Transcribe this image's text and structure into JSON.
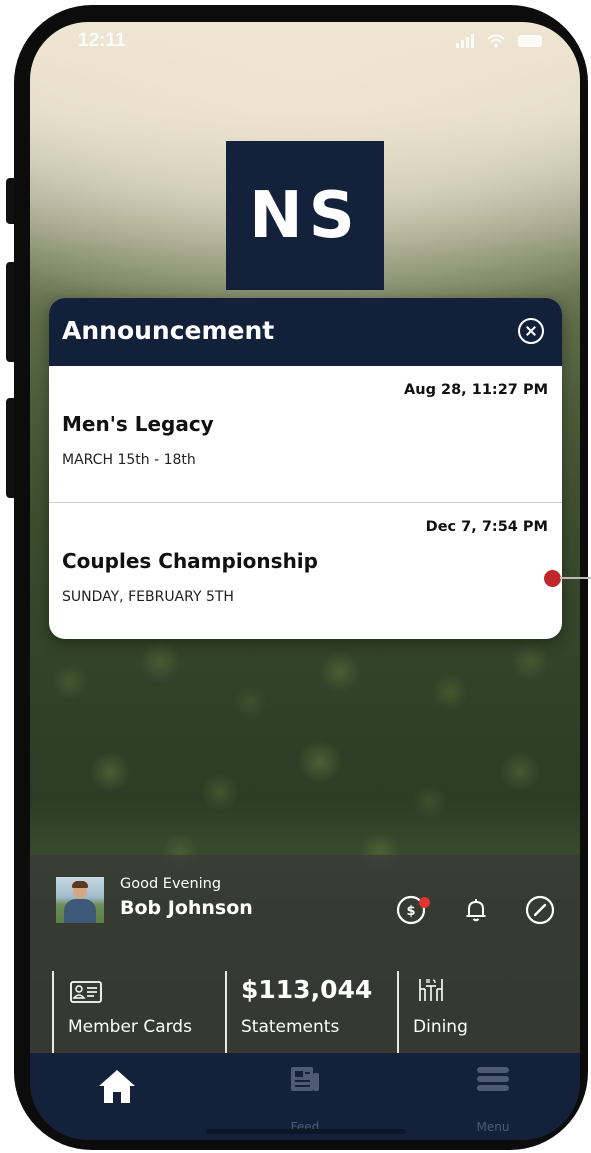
{
  "status_bar": {
    "time": "12:11"
  },
  "logo": {
    "text": "NS"
  },
  "announcement": {
    "title": "Announcement",
    "items": [
      {
        "date": "Aug 28, 11:27 PM",
        "title": "Men's Legacy",
        "subtitle": "MARCH 15th - 18th"
      },
      {
        "date": "Dec 7, 7:54 PM",
        "title": "Couples Championship",
        "subtitle": "SUNDAY, FEBRUARY 5TH"
      }
    ]
  },
  "user": {
    "greeting": "Good Evening",
    "name": "Bob Johnson"
  },
  "header_icons": [
    "dollar-icon",
    "bell-icon",
    "compass-icon"
  ],
  "tiles": [
    {
      "label": "Member Cards",
      "icon": "member-card-icon"
    },
    {
      "label": "Statements",
      "amount": "$113,044"
    },
    {
      "label": "Dining",
      "icon": "dining-icon"
    }
  ],
  "tabbar": {
    "items": [
      {
        "label": "",
        "icon": "home-icon"
      },
      {
        "label": "Feed",
        "icon": "feed-icon"
      },
      {
        "label": "Menu",
        "icon": "menu-icon"
      }
    ]
  },
  "colors": {
    "navy": "#13213b",
    "notification_red": "#e0342f",
    "marker_red": "#c0272d",
    "white": "#ffffff"
  }
}
